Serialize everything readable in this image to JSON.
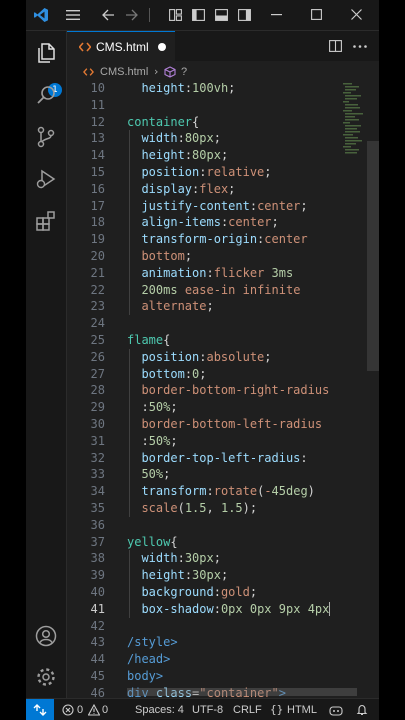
{
  "titlebar": {
    "menu_icon": "hamburger-menu-icon",
    "back_icon": "arrow-left-icon",
    "forward_icon": "arrow-right-icon"
  },
  "activity_bar": {
    "explorer_badge": "1",
    "items": [
      "explorer-icon",
      "search-icon",
      "source-control-icon",
      "run-debug-icon",
      "extensions-icon"
    ],
    "bottom_items": [
      "account-icon",
      "settings-gear-icon"
    ]
  },
  "tab": {
    "label": "CMS.html"
  },
  "breadcrumb": {
    "file": "CMS.html",
    "symbol": "?"
  },
  "editor": {
    "lines": [
      {
        "n": "10",
        "text": "  height:100vh;"
      },
      {
        "n": "11",
        "text": ""
      },
      {
        "n": "12",
        "text": "container{"
      },
      {
        "n": "13",
        "text": "  width:80px;"
      },
      {
        "n": "14",
        "text": "  height:80px;"
      },
      {
        "n": "15",
        "text": "  position:relative;"
      },
      {
        "n": "16",
        "text": "  display:flex;"
      },
      {
        "n": "17",
        "text": "  justify-content:center;"
      },
      {
        "n": "18",
        "text": "  align-items:center;"
      },
      {
        "n": "19",
        "text": "  transform-origin:center"
      },
      {
        "n": "20",
        "text": "  bottom;"
      },
      {
        "n": "21",
        "text": "  animation:flicker 3ms"
      },
      {
        "n": "22",
        "text": "  200ms ease-in infinite"
      },
      {
        "n": "23",
        "text": "  alternate;"
      },
      {
        "n": "24",
        "text": ""
      },
      {
        "n": "25",
        "text": "flame{"
      },
      {
        "n": "26",
        "text": "  position:absolute;"
      },
      {
        "n": "27",
        "text": "  bottom:0;"
      },
      {
        "n": "28",
        "text": "  border-bottom-right-radius"
      },
      {
        "n": "29",
        "text": "  :50%;"
      },
      {
        "n": "30",
        "text": "  border-bottom-left-radius"
      },
      {
        "n": "31",
        "text": "  :50%;"
      },
      {
        "n": "32",
        "text": "  border-top-left-radius:"
      },
      {
        "n": "33",
        "text": "  50%;"
      },
      {
        "n": "34",
        "text": "  transform:rotate(-45deg)"
      },
      {
        "n": "35",
        "text": "  scale(1.5, 1.5);"
      },
      {
        "n": "36",
        "text": ""
      },
      {
        "n": "37",
        "text": "yellow{"
      },
      {
        "n": "38",
        "text": "  width:30px;"
      },
      {
        "n": "39",
        "text": "  height:30px;"
      },
      {
        "n": "40",
        "text": "  background:gold;"
      },
      {
        "n": "41",
        "text": "  box-shadow:0px 0px 9px 4px"
      },
      {
        "n": "42",
        "text": ""
      },
      {
        "n": "43",
        "text": "/style>"
      },
      {
        "n": "44",
        "text": "/head>"
      },
      {
        "n": "45",
        "text": "body>"
      },
      {
        "n": "46",
        "text": "div class=\"container\">"
      }
    ],
    "active_line": "41"
  },
  "status_bar": {
    "errors": "0",
    "warnings": "0",
    "spaces": "Spaces: 4",
    "encoding": "UTF-8",
    "eol": "CRLF",
    "language": "HTML"
  },
  "colors": {
    "selector": "#4ec9b0",
    "property": "#9cdcfe",
    "value": "#ce9178",
    "number": "#b5cea8",
    "tag": "#569cd6",
    "accent": "#0078d4"
  }
}
